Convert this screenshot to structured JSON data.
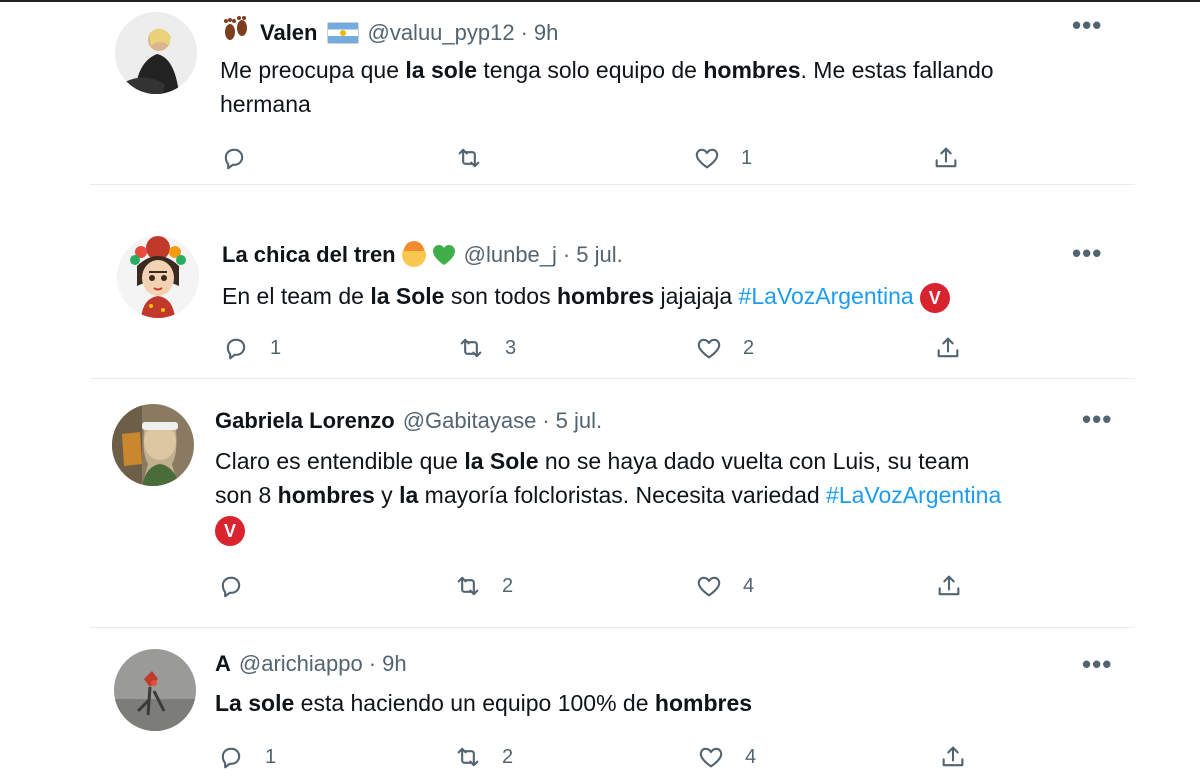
{
  "tweets": [
    {
      "name": "Valen",
      "handle": "@valuu_pyp12",
      "time": "9h",
      "text_parts": [
        "Me preocupa que ",
        "la sole",
        " tenga solo equipo de ",
        "hombres",
        ". Me estas fallando"
      ],
      "text_line2": "hermana",
      "reply_count": "",
      "retweet_count": "",
      "like_count": "1"
    },
    {
      "name": "La chica del tren",
      "handle": "@lunbe_j",
      "time": "5 jul.",
      "text_parts": [
        "En el team de ",
        "la Sole",
        " son todos ",
        "hombres",
        " jajajaja "
      ],
      "hashtag": "#LaVozArgentina",
      "reply_count": "1",
      "retweet_count": "3",
      "like_count": "2"
    },
    {
      "name": "Gabriela Lorenzo",
      "handle": "@Gabitayase",
      "time": "5 jul.",
      "line1_parts": [
        "Claro es entendible que ",
        "la Sole",
        " no se haya dado vuelta con Luis, su team"
      ],
      "line2_parts": [
        "son 8 ",
        "hombres",
        " y ",
        "la",
        " mayoría folcloristas. Necesita variedad "
      ],
      "hashtag": "#LaVozArgentina",
      "reply_count": "",
      "retweet_count": "2",
      "like_count": "4"
    },
    {
      "name": "A",
      "handle": "@arichiappo",
      "time": "9h",
      "text_parts": [
        "La sole",
        " esta haciendo un equipo 100% de ",
        "hombres"
      ],
      "reply_count": "1",
      "retweet_count": "2",
      "like_count": "4"
    }
  ],
  "separator": "·",
  "more_label": "•••",
  "badge_letter": "V",
  "icons": {
    "reply": "reply-icon",
    "retweet": "retweet-icon",
    "like": "heart-icon",
    "share": "share-icon",
    "more": "more-icon"
  },
  "colors": {
    "text": "#0f1419",
    "muted": "#536471",
    "link": "#1d9bf0",
    "divider": "#e6ecf0",
    "badge": "#d9232e"
  }
}
